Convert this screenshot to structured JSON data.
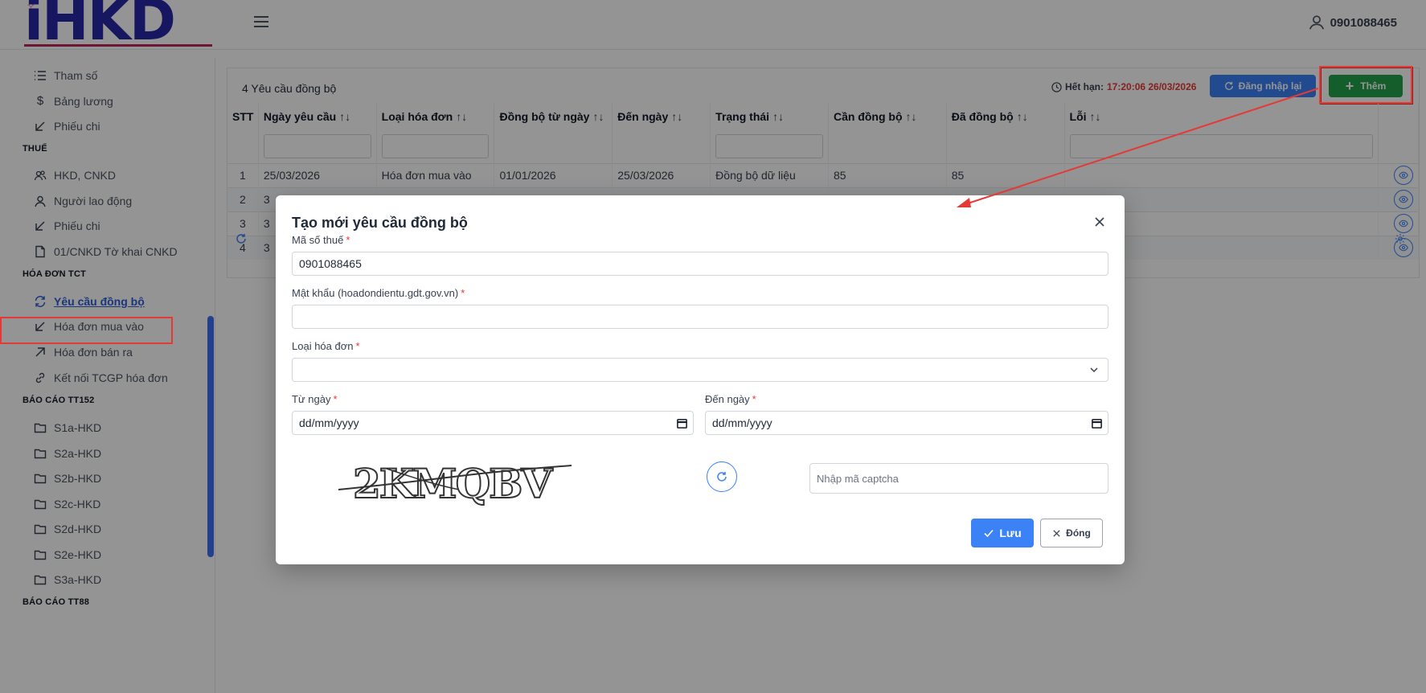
{
  "header": {
    "logo_text": "iHKD",
    "user": "0901088465"
  },
  "sidebar": {
    "items": [
      {
        "label": "Tham số",
        "icon": "list-icon"
      },
      {
        "label": "Bảng lương",
        "icon": "dollar-icon"
      },
      {
        "label": "Phiếu chi",
        "icon": "arrow-down-left-icon"
      }
    ],
    "section_thue": "THUẾ",
    "thue_items": [
      {
        "label": "HKD, CNKD",
        "icon": "users-icon"
      },
      {
        "label": "Người lao động",
        "icon": "user-icon"
      },
      {
        "label": "Phiếu chi",
        "icon": "arrow-down-left-icon"
      },
      {
        "label": "01/CNKD Tờ khai CNKD",
        "icon": "file-icon"
      }
    ],
    "section_hoadon": "HÓA ĐƠN TCT",
    "hoadon_items": [
      {
        "label": "Yêu cầu đồng bộ",
        "icon": "sync-icon"
      },
      {
        "label": "Hóa đơn mua vào",
        "icon": "arrow-down-left-icon"
      },
      {
        "label": "Hóa đơn bán ra",
        "icon": "arrow-up-right-icon"
      },
      {
        "label": "Kết nối TCGP hóa đơn",
        "icon": "link-icon"
      }
    ],
    "section_tt152": "BÁO CÁO TT152",
    "tt152_items": [
      {
        "label": "S1a-HKD"
      },
      {
        "label": "S2a-HKD"
      },
      {
        "label": "S2b-HKD"
      },
      {
        "label": "S2c-HKD"
      },
      {
        "label": "S2d-HKD"
      },
      {
        "label": "S2e-HKD"
      },
      {
        "label": "S3a-HKD"
      }
    ],
    "section_tt88": "BÁO CÁO TT88"
  },
  "main": {
    "title": "4 Yêu cầu đồng bộ",
    "expire_label": "Hết hạn:",
    "expire_value": "17:20:06 26/03/2026",
    "login_again": "Đăng nhập lại",
    "add": "Thêm",
    "columns": [
      "STT",
      "Ngày yêu cầu",
      "Loại hóa đơn",
      "Đồng bộ từ ngày",
      "Đến ngày",
      "Trạng thái",
      "Cần đồng bộ",
      "Đã đồng bộ",
      "Lỗi"
    ],
    "rows": [
      {
        "stt": "1",
        "ngay": "25/03/2026",
        "loai": "Hóa đơn mua vào",
        "tu": "01/01/2026",
        "den": "25/03/2026",
        "trangthai": "Đồng bộ dữ liệu",
        "can": "85",
        "da": "85",
        "loi": ""
      },
      {
        "stt": "2",
        "ngay": "3",
        "loai": "",
        "tu": "",
        "den": "",
        "trangthai": "",
        "can": "",
        "da": "",
        "loi": ""
      },
      {
        "stt": "3",
        "ngay": "3",
        "loai": "",
        "tu": "",
        "den": "",
        "trangthai": "",
        "can": "",
        "da": "",
        "loi": ""
      },
      {
        "stt": "4",
        "ngay": "3",
        "loai": "",
        "tu": "",
        "den": "",
        "trangthai": "",
        "can": "",
        "da": "",
        "loi": ""
      }
    ]
  },
  "modal": {
    "title": "Tạo mới yêu cầu đồng bộ",
    "mst_label": "Mã số thuế",
    "mst_value": "0901088465",
    "password_label": "Mật khẩu (hoadondientu.gdt.gov.vn)",
    "password_value": "",
    "invoice_type_label": "Loại hóa đơn",
    "invoice_type_value": "",
    "from_label": "Từ ngày",
    "from_value": "dd/mm/yyyy",
    "to_label": "Đến ngày",
    "to_value": "dd/mm/yyyy",
    "captcha_text": "2KMQBV",
    "captcha_placeholder": "Nhập mã captcha",
    "required_mark": "*",
    "save": "Lưu",
    "close": "Đóng"
  },
  "colors": {
    "primary": "#3b82f6",
    "success": "#22a34a",
    "danger": "#e53935",
    "logo": "#2727a8"
  }
}
